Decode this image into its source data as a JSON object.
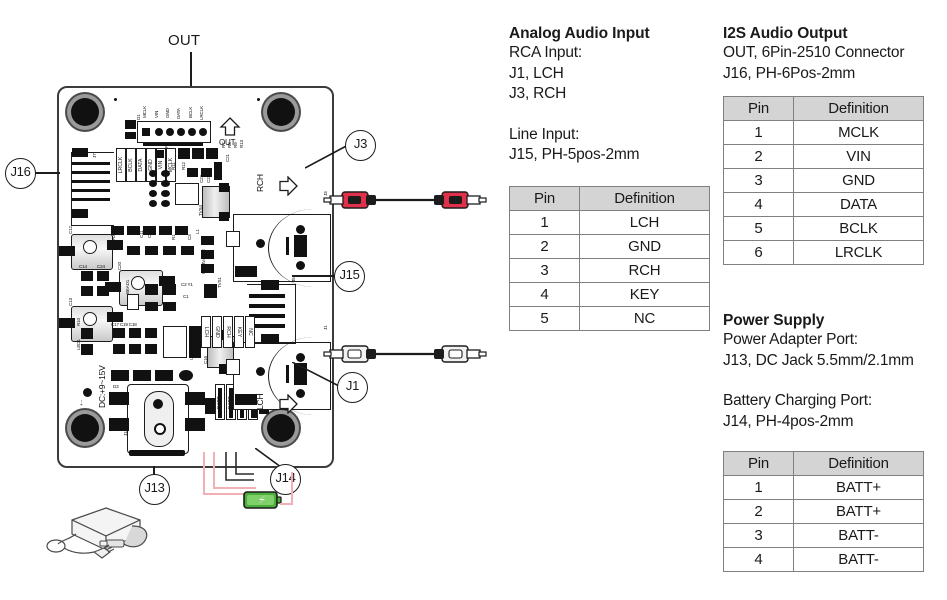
{
  "sections": {
    "analog": {
      "title": "Analog Audio Input",
      "lines": [
        "RCA Input:",
        "J1, LCH",
        "J3, RCH"
      ],
      "sub_lines": [
        "Line Input:",
        "J15, PH-5pos-2mm"
      ],
      "table": {
        "headers": [
          "Pin",
          "Definition"
        ],
        "rows": [
          [
            "1",
            "LCH"
          ],
          [
            "2",
            "GND"
          ],
          [
            "3",
            "RCH"
          ],
          [
            "4",
            "KEY"
          ],
          [
            "5",
            "NC"
          ]
        ]
      }
    },
    "i2s": {
      "title": "I2S Audio Output",
      "lines": [
        "OUT, 6Pin-2510 Connector",
        "J16, PH-6Pos-2mm"
      ],
      "table": {
        "headers": [
          "Pin",
          "Definition"
        ],
        "rows": [
          [
            "1",
            "MCLK"
          ],
          [
            "2",
            "VIN"
          ],
          [
            "3",
            "GND"
          ],
          [
            "4",
            "DATA"
          ],
          [
            "5",
            "BCLK"
          ],
          [
            "6",
            "LRCLK"
          ]
        ]
      }
    },
    "power": {
      "title": "Power Supply",
      "lines": [
        "Power Adapter Port:",
        "J13, DC Jack 5.5mm/2.1mm"
      ],
      "sub_lines": [
        "Battery Charging Port:",
        "J14, PH-4pos-2mm"
      ],
      "table": {
        "headers": [
          "Pin",
          "Definition"
        ],
        "rows": [
          [
            "1",
            "BATT+"
          ],
          [
            "2",
            "BATT+"
          ],
          [
            "3",
            "BATT-"
          ],
          [
            "4",
            "BATT-"
          ]
        ]
      }
    }
  },
  "board": {
    "out_label": "OUT",
    "out_arrow_label": "OUT",
    "rch_label": "RCH",
    "lch_label": "LCH",
    "dc_label": "DC:+9~15V",
    "header_pins": [
      "MCLK",
      "VIN",
      "GND",
      "DATA",
      "BCLK",
      "LRCLK"
    ],
    "j16_pins": [
      "MCLK",
      "VIN",
      "GND",
      "DATA",
      "BCLK",
      "LRCLK"
    ],
    "j15_pins": [
      "LCH",
      "GND",
      "RCH",
      "KEY",
      "NC"
    ],
    "j14_pins": [
      "BATT-",
      "BATT-",
      "BATT+",
      "BATT+"
    ],
    "refdes": [
      "D1",
      "R4",
      "R7",
      "R8",
      "R9",
      "R13",
      "R11",
      "R12",
      "C3",
      "C8",
      "C9",
      "C21",
      "C22",
      "C23",
      "C7",
      "C6",
      "C4",
      "TVS4",
      "L1",
      "C12",
      "C13",
      "C14",
      "C24",
      "C20",
      "R3",
      "R3",
      "C11",
      "C10",
      "R5",
      "R1",
      "R6",
      "C3",
      "RV3",
      "RV4",
      "RV2",
      "BEAD1",
      "C2",
      "Y1",
      "C1",
      "TVS1",
      "C17",
      "C19",
      "C18",
      "R10",
      "LED1",
      "U2",
      "C16",
      "C5",
      "D3",
      "D7",
      "J13",
      "J5",
      "J1",
      "J7"
    ],
    "callouts": [
      "J16",
      "J3",
      "J15",
      "J1",
      "J13",
      "J14"
    ]
  },
  "accents": {
    "rca_red": "#e0304a",
    "rca_white": "#f2f2f2",
    "battery_green": "#4caf3c",
    "wire_red": "#f0b0b4",
    "table_header_gray": "#d4d4d4",
    "board_outline": "#3c3c3c"
  }
}
